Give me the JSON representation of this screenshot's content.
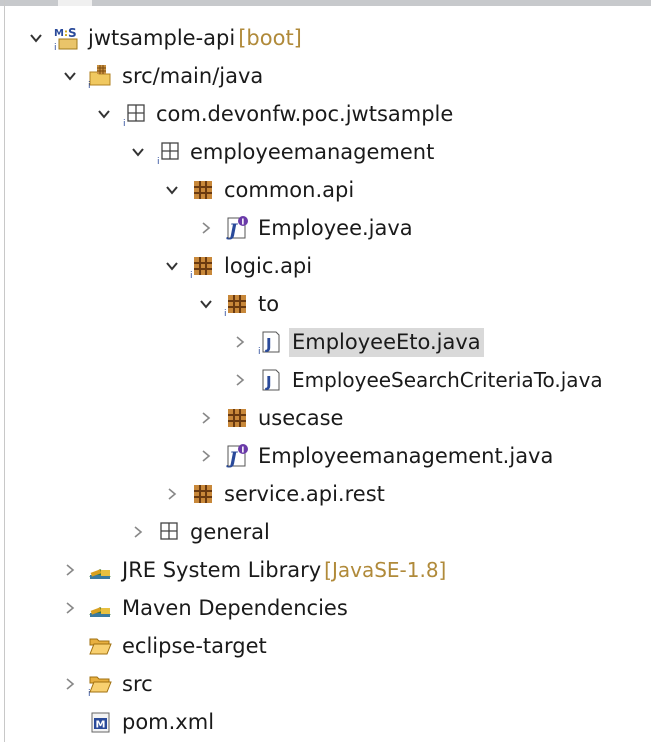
{
  "tree": [
    {
      "label": "jwtsample-api",
      "decoration": "[boot]",
      "icon": "maven-project-icon",
      "expanded": true
    },
    {
      "label": "src/main/java",
      "icon": "source-folder-icon",
      "expanded": true
    },
    {
      "label": "com.devonfw.poc.jwtsample",
      "icon": "empty-package-icon",
      "expanded": true
    },
    {
      "label": "employeemanagement",
      "icon": "empty-package-icon",
      "expanded": true
    },
    {
      "label": "common.api",
      "icon": "package-icon",
      "expanded": true
    },
    {
      "label": "Employee.java",
      "icon": "java-interface-icon",
      "expanded": false
    },
    {
      "label": "logic.api",
      "icon": "package-icon",
      "expanded": true
    },
    {
      "label": "to",
      "icon": "package-icon",
      "expanded": true
    },
    {
      "label": "EmployeeEto.java",
      "icon": "java-class-icon",
      "expanded": false,
      "selected": true
    },
    {
      "label": "EmployeeSearchCriteriaTo.java",
      "icon": "java-class-icon",
      "expanded": false
    },
    {
      "label": "usecase",
      "icon": "package-icon",
      "expanded": false
    },
    {
      "label": "Employeemanagement.java",
      "icon": "java-interface-icon",
      "expanded": false
    },
    {
      "label": "service.api.rest",
      "icon": "package-icon",
      "expanded": false
    },
    {
      "label": "general",
      "icon": "empty-package-icon",
      "expanded": false
    },
    {
      "label": "JRE System Library",
      "decoration": "[JavaSE-1.8]",
      "icon": "library-icon",
      "expanded": false
    },
    {
      "label": "Maven Dependencies",
      "icon": "library-icon",
      "expanded": false
    },
    {
      "label": "eclipse-target",
      "icon": "folder-icon"
    },
    {
      "label": "src",
      "icon": "folder-icon",
      "expanded": false
    },
    {
      "label": "pom.xml",
      "icon": "maven-file-icon"
    }
  ]
}
